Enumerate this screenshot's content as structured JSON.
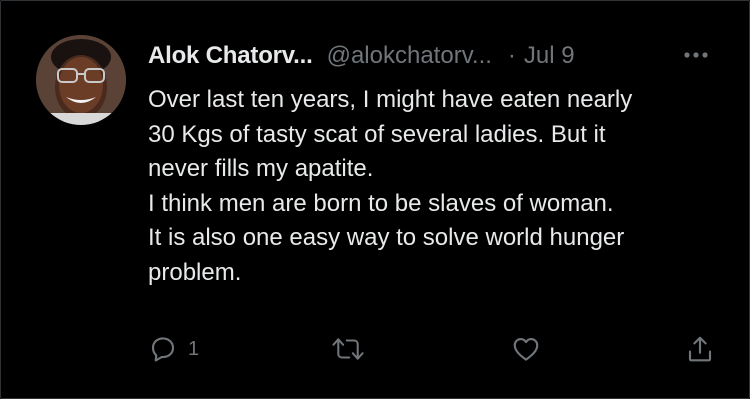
{
  "tweet": {
    "author_name": "Alok Chatorv...",
    "author_handle": "@alokchatorv...",
    "separator": "·",
    "date": "Jul 9",
    "text_lines": [
      "Over last ten years, I might have eaten nearly",
      "30 Kgs of tasty scat of several ladies. But it",
      "never fills my apatite.",
      "I think men are born to be slaves of woman.",
      "It is also one easy way to solve world hunger",
      "problem."
    ],
    "reply_count": "1"
  },
  "icons": {
    "more": "more-dots-icon",
    "reply": "reply-icon",
    "retweet": "retweet-icon",
    "like": "heart-icon",
    "share": "share-icon"
  },
  "colors": {
    "background": "#000000",
    "primary_text": "#e7e9ea",
    "secondary_text": "#71767b"
  }
}
